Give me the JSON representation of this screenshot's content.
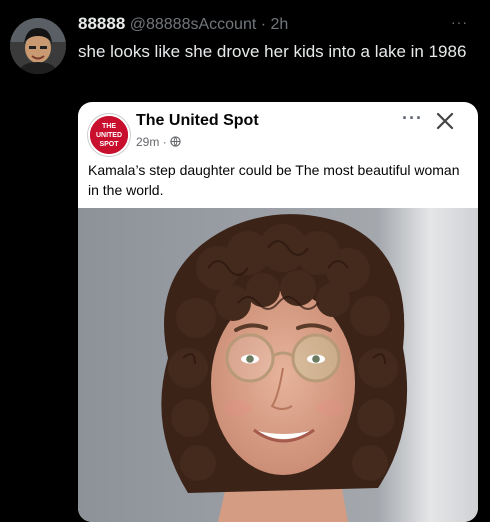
{
  "tweet": {
    "display_name": "88888",
    "handle": "@88888sAccount",
    "separator": "·",
    "time": "2h",
    "more": "···",
    "text": "she looks like she drove her kids into a lake in 1986",
    "avatar_icon": "user-avatar"
  },
  "embed": {
    "page_name": "The United Spot",
    "time": "29m",
    "separator": "·",
    "audience_icon": "globe-icon",
    "more": "···",
    "close_icon": "close-icon",
    "caption": "Kamala’s step daughter could be The most beautiful woman in the world.",
    "logo": {
      "line1": "THE",
      "line2": "UNITED",
      "line3": "SPOT"
    },
    "photo_description_icon": "photo-woman-curly-hair-glasses"
  },
  "colors": {
    "background": "#000000",
    "text_primary": "#e7e9ea",
    "text_secondary": "#71767b",
    "logo_red": "#c8102e"
  }
}
